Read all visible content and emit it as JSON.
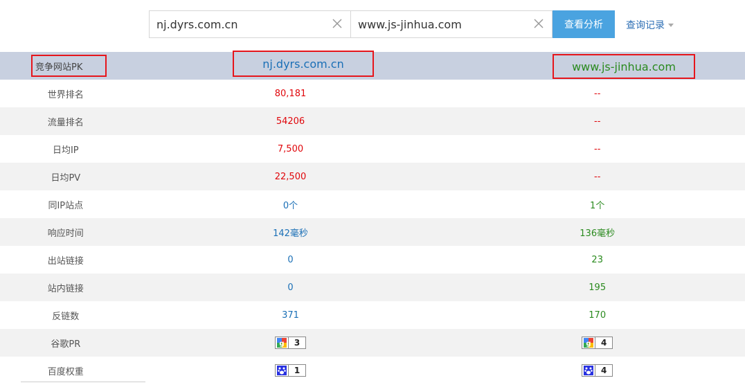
{
  "search": {
    "site_a": "nj.dyrs.com.cn",
    "site_b": "www.js-jinhua.com",
    "analyze_label": "查看分析",
    "history_label": "查询记录"
  },
  "header": {
    "col1": "竞争网站PK",
    "col2": "nj.dyrs.com.cn",
    "col3": "www.js-jinhua.com"
  },
  "rows": [
    {
      "label": "世界排名",
      "a": "80,181",
      "b": "--"
    },
    {
      "label": "流量排名",
      "a": "54206",
      "b": "--"
    },
    {
      "label": "日均IP",
      "a": "7,500",
      "b": "--"
    },
    {
      "label": "日均PV",
      "a": "22,500",
      "b": "--"
    },
    {
      "label": "同IP站点",
      "a": "0个",
      "b": "1个"
    },
    {
      "label": "响应时间",
      "a": "142毫秒",
      "b": "136毫秒"
    },
    {
      "label": "出站链接",
      "a": "0",
      "b": "23"
    },
    {
      "label": "站内链接",
      "a": "0",
      "b": "195"
    },
    {
      "label": "反链数",
      "a": "371",
      "b": "170"
    },
    {
      "label": "谷歌PR",
      "a": "3",
      "b": "4",
      "icon": "google-g-icon"
    },
    {
      "label": "百度权重",
      "a": "1",
      "b": "4",
      "icon": "baidu-paw-icon"
    }
  ],
  "colors": {
    "header_bg": "#c8d0e0",
    "button_bg": "#4aa3e0",
    "highlight_box": "#e6151b",
    "site_a_text": "#1a6fb6",
    "site_b_text": "#2a8a1e",
    "rank_text": "#e0060b"
  }
}
